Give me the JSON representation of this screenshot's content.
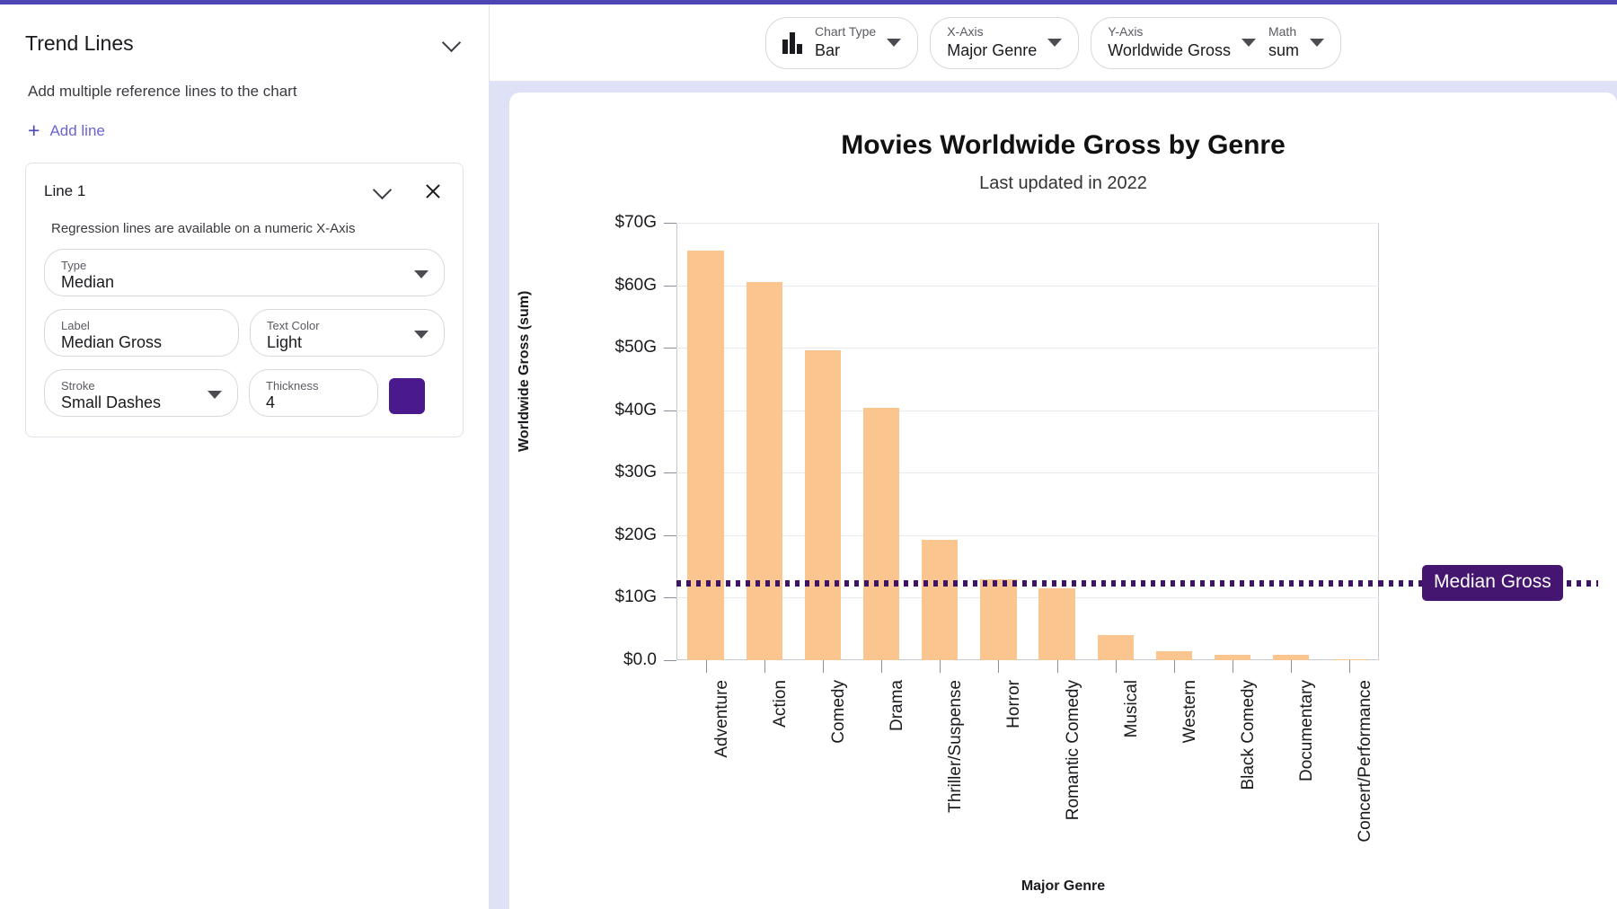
{
  "theme": {
    "accent": "#4f46b5",
    "bar_color": "#fac58e",
    "trend_color": "#3d1466",
    "badge_bg": "#45166f",
    "swatch_color": "#4a1a8c"
  },
  "sidebar": {
    "title": "Trend Lines",
    "collapse_icon": "chevron-up-icon",
    "description": "Add multiple reference lines to the chart",
    "add_line_label": "Add line",
    "add_icon": "plus-icon",
    "line_card": {
      "title": "Line 1",
      "collapse_icon": "chevron-up-icon",
      "close_icon": "close-icon",
      "hint": "Regression lines are available on a numeric X-Axis",
      "fields": {
        "type": {
          "label": "Type",
          "value": "Median"
        },
        "label": {
          "label": "Label",
          "value": "Median Gross"
        },
        "text_color": {
          "label": "Text Color",
          "value": "Light"
        },
        "stroke": {
          "label": "Stroke",
          "value": "Small Dashes"
        },
        "thickness": {
          "label": "Thickness",
          "value": "4"
        },
        "color_swatch": {
          "name": "line-color-swatch",
          "value": "#4a1a8c"
        }
      }
    }
  },
  "collapse_handle": {
    "icon": "chevron-left-icon"
  },
  "toolbar": {
    "chart_type": {
      "label": "Chart Type",
      "value": "Bar",
      "icon": "bar-chart-icon"
    },
    "x_axis": {
      "label": "X-Axis",
      "value": "Major Genre"
    },
    "y_axis": {
      "label": "Y-Axis",
      "value": "Worldwide Gross"
    },
    "math": {
      "label": "Math",
      "value": "sum"
    }
  },
  "chart_data": {
    "type": "bar",
    "title": "Movies Worldwide Gross by Genre",
    "subtitle": "Last updated in 2022",
    "xlabel": "Major Genre",
    "ylabel": "Worldwide Gross (sum)",
    "grid": true,
    "legend": "none",
    "ylim": [
      0,
      70
    ],
    "ytick_labels": [
      "$0.0",
      "$10G",
      "$20G",
      "$30G",
      "$40G",
      "$50G",
      "$60G",
      "$70G"
    ],
    "ytick_values": [
      0,
      10,
      20,
      30,
      40,
      50,
      60,
      70
    ],
    "categories": [
      "Adventure",
      "Action",
      "Comedy",
      "Drama",
      "Thriller/Suspense",
      "Horror",
      "Romantic Comedy",
      "Musical",
      "Western",
      "Black Comedy",
      "Documentary",
      "Concert/Performance"
    ],
    "values": [
      65.6,
      60.5,
      49.6,
      40.4,
      19.2,
      13.0,
      11.5,
      4.0,
      1.4,
      0.9,
      0.8,
      0.15
    ],
    "unit": "billions USD",
    "annotations": [
      {
        "type": "median-line",
        "label": "Median Gross",
        "value": 12.3,
        "stroke": "Small Dashes",
        "thickness": 4,
        "color": "#3d1466"
      }
    ]
  }
}
